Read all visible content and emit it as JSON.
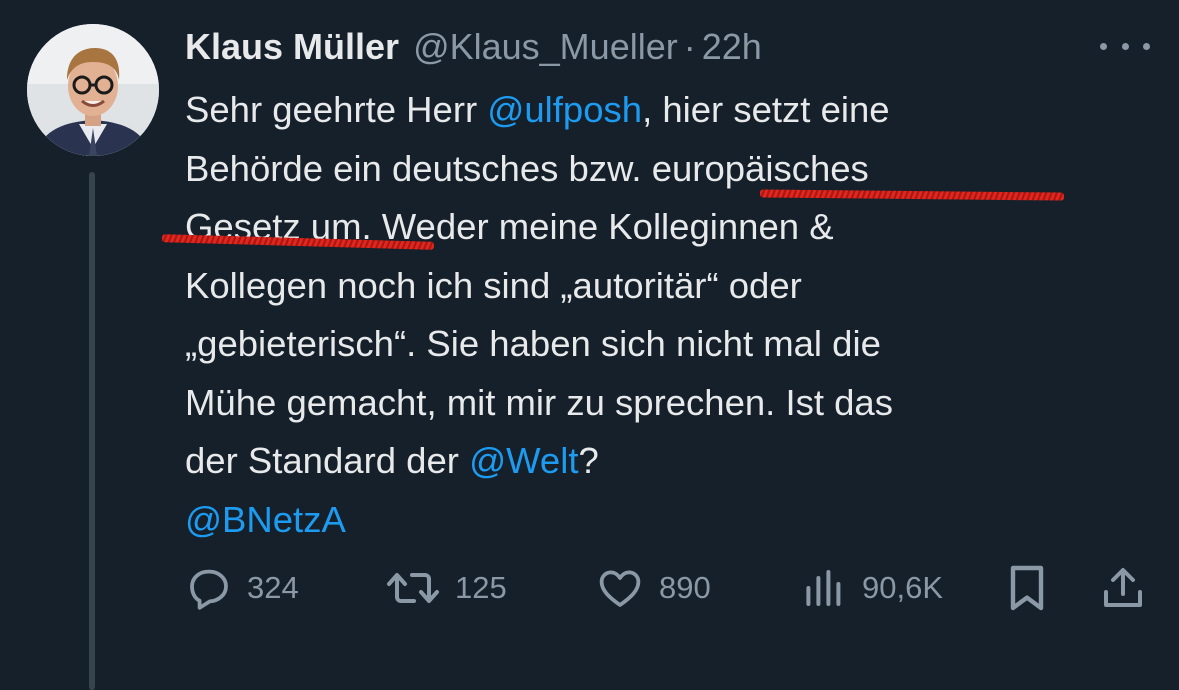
{
  "tweet": {
    "author_name": "Klaus Müller",
    "handle": "@Klaus_Mueller",
    "separator": "·",
    "time": "22h",
    "lines": [
      [
        {
          "t": "Sehr geehrte Herr "
        },
        {
          "t": "@ulfposh",
          "m": true
        },
        {
          "t": ", hier setzt eine"
        }
      ],
      [
        {
          "t": "Behörde ein deutsches bzw. europäisches"
        }
      ],
      [
        {
          "t": "Gesetz um. Weder meine Kolleginnen &"
        }
      ],
      [
        {
          "t": "Kollegen noch ich sind „autoritär“ oder"
        }
      ],
      [
        {
          "t": "„gebieterisch“. Sie haben sich nicht mal die"
        }
      ],
      [
        {
          "t": "Mühe gemacht, mit mir zu sprechen. Ist das"
        }
      ],
      [
        {
          "t": "der Standard der "
        },
        {
          "t": "@Welt",
          "m": true
        },
        {
          "t": "?"
        }
      ],
      [
        {
          "t": "@BNetzA",
          "m": true
        }
      ]
    ]
  },
  "actions": {
    "replies": "324",
    "retweets": "125",
    "likes": "890",
    "views": "90,6K"
  },
  "colors": {
    "background": "#15202b",
    "text": "#e7e9ea",
    "muted": "#8b98a5",
    "link": "#1d9bf0",
    "annotation": "#e0261e"
  }
}
